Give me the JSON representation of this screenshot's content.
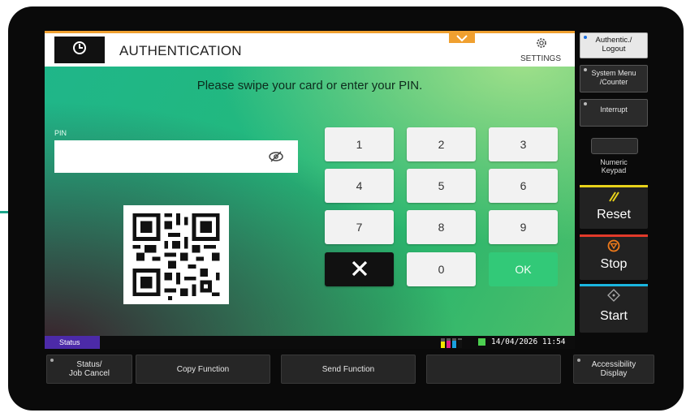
{
  "header": {
    "title": "AUTHENTICATION",
    "settings_label": "SETTINGS",
    "accent_color": "#f0a030"
  },
  "main": {
    "instruction": "Please swipe your card or enter your PIN.",
    "pin_label": "PIN",
    "pin_value": ""
  },
  "keypad": {
    "keys": [
      "1",
      "2",
      "3",
      "4",
      "5",
      "6",
      "7",
      "8",
      "9"
    ],
    "zero": "0",
    "ok": "OK"
  },
  "statusbar": {
    "status_tab": "Status",
    "datetime": "14/04/2026  11:54",
    "status_tab_color": "#4c2aa8"
  },
  "hw_panel": {
    "authentic_logout": "Authentic./\nLogout",
    "system_menu": "System Menu\n/Counter",
    "interrupt": "Interrupt",
    "numeric_keypad": "Numeric\nKeypad",
    "reset": "Reset",
    "stop": "Stop",
    "start": "Start",
    "accessibility": "Accessibility\nDisplay"
  },
  "bottom": {
    "status_job_cancel": "Status/\nJob Cancel",
    "copy_function": "Copy Function",
    "send_function": "Send Function"
  }
}
